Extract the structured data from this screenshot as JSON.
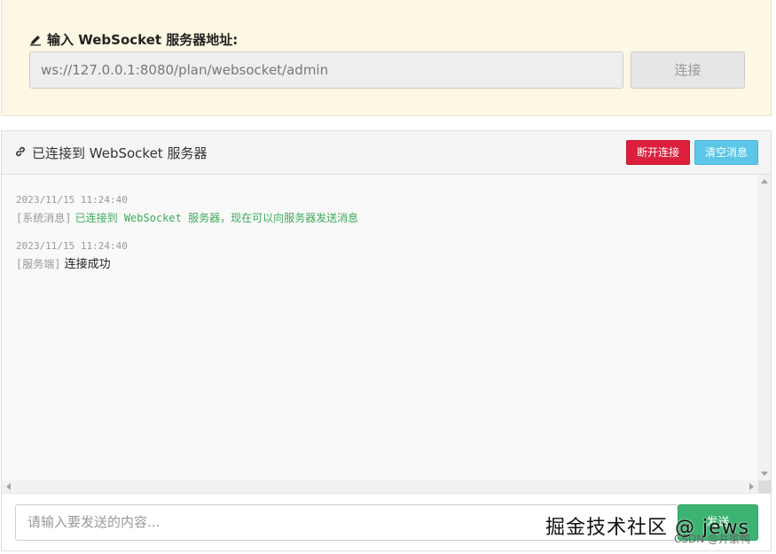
{
  "header": {
    "label": "输入 WebSocket 服务器地址:",
    "url_value": "ws://127.0.0.1:8080/plan/websocket/admin",
    "connect_label": "连接"
  },
  "panel": {
    "title": "已连接到 WebSocket 服务器",
    "disconnect_label": "断开连接",
    "clear_label": "清空消息"
  },
  "messages": [
    {
      "time": "2023/11/15 11:24:40",
      "tag": "[系统消息]",
      "text": "已连接到 WebSocket 服务器，现在可以向服务器发送消息"
    },
    {
      "time": "2023/11/15 11:24:40",
      "tag": "[服务端]",
      "text": "连接成功"
    }
  ],
  "composer": {
    "placeholder": "请输入要发送的内容...",
    "send_label": "发送"
  },
  "watermark": {
    "main": "掘金技术社区 @ jews",
    "sub": "CSDN @井家鸭"
  },
  "colors": {
    "top_bg": "#fcf8e3",
    "danger": "#dc1f3c",
    "info": "#5bc6e8",
    "success": "#3cb371",
    "system_text": "#3cab5a"
  },
  "icons": {
    "label_icon": "pencil-icon",
    "title_icon": "link-icon"
  }
}
